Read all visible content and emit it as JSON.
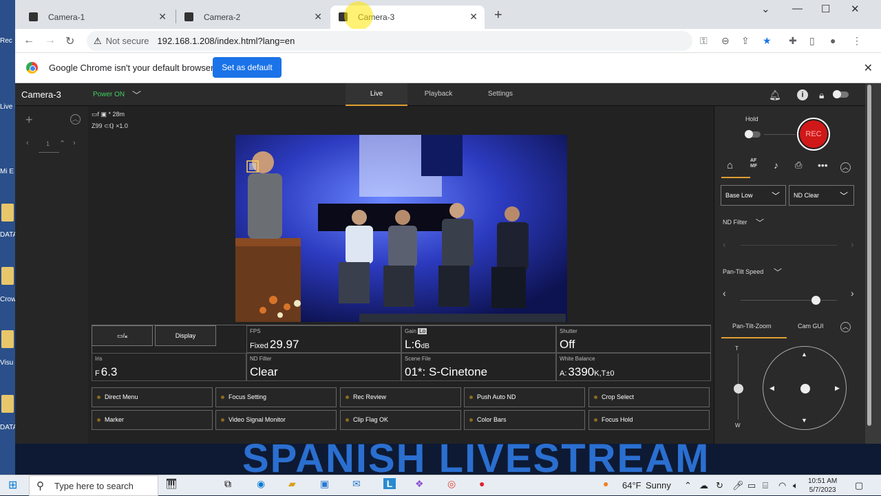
{
  "desktop": {
    "icons": [
      "Rec",
      "Live Pro",
      "Mi E",
      "DATA",
      "Crow S",
      "Visu",
      "DATA"
    ]
  },
  "background_banner": "SPANISH LIVESTREAM",
  "browser": {
    "tabs": [
      {
        "title": "Camera-1",
        "active": false
      },
      {
        "title": "Camera-2",
        "active": false
      },
      {
        "title": "Camera-3",
        "active": true
      }
    ],
    "new_tab_symbol": "+",
    "window_controls": {
      "minimize": "—",
      "maximize": "☐",
      "close": "✕"
    },
    "address": {
      "security_label": "Not secure",
      "url": "192.168.1.208/index.html?lang=en"
    },
    "infobar": {
      "message": "Google Chrome isn't your default browser",
      "button": "Set as default"
    }
  },
  "app": {
    "camera_name": "Camera-3",
    "power_status": "Power ON",
    "nav_tabs": [
      {
        "label": "Live",
        "active": true
      },
      {
        "label": "Playback",
        "active": false
      },
      {
        "label": "Settings",
        "active": false
      }
    ],
    "left_panel": {
      "page_number": "1"
    },
    "osd": {
      "line1": "* 28m",
      "line2_a": "Z99",
      "line2_b": "×1.0"
    },
    "status_grid": {
      "clip_button": "▭/𝄪",
      "display_button": "Display",
      "fps": {
        "label": "FPS",
        "prefix": "Fixed",
        "value": "29.97"
      },
      "gain": {
        "label": "Gain",
        "badge": "Lo",
        "value": "L:6",
        "unit": "dB"
      },
      "shutter": {
        "label": "Shutter",
        "value": "Off"
      },
      "iris": {
        "label": "Iris",
        "prefix": "F",
        "value": "6.3"
      },
      "nd_filter": {
        "label": "ND Filter",
        "value": "Clear"
      },
      "scene_file": {
        "label": "Scene File",
        "value": "01*: S-Cinetone"
      },
      "white_balance": {
        "label": "White Balance",
        "prefix": "A:",
        "value": "3390",
        "suffix": "K,T±0"
      }
    },
    "menu_buttons": [
      "Direct Menu",
      "Focus Setting",
      "Rec Review",
      "Push Auto ND",
      "Crop Select",
      "Marker",
      "Video Signal Monitor",
      "Clip Flag OK",
      "Color Bars",
      "Focus Hold"
    ],
    "right_panel": {
      "hold_label": "Hold",
      "rec_label": "REC",
      "af_mf_label": "AF MF",
      "base_select": "Base Low",
      "nd_select": "ND Clear",
      "nd_filter_label": "ND Filter",
      "pan_tilt_speed_label": "Pan-Tilt Speed",
      "pan_tilt_speed_level": 0.78,
      "tabs": [
        {
          "label": "Pan-Tilt-Zoom",
          "active": true
        },
        {
          "label": "Cam GUI",
          "active": false
        }
      ],
      "zoom_t": "T",
      "zoom_w": "W"
    }
  },
  "taskbar": {
    "search_placeholder": "Type here to search",
    "weather_temp": "64°F",
    "weather_text": "Sunny",
    "time": "10:51 AM",
    "date": "5/7/2023"
  },
  "colors": {
    "accent_live_tab": "#e0a030",
    "power_on": "#40d060",
    "rec": "#d01818",
    "chrome_blue": "#1a73e8"
  }
}
